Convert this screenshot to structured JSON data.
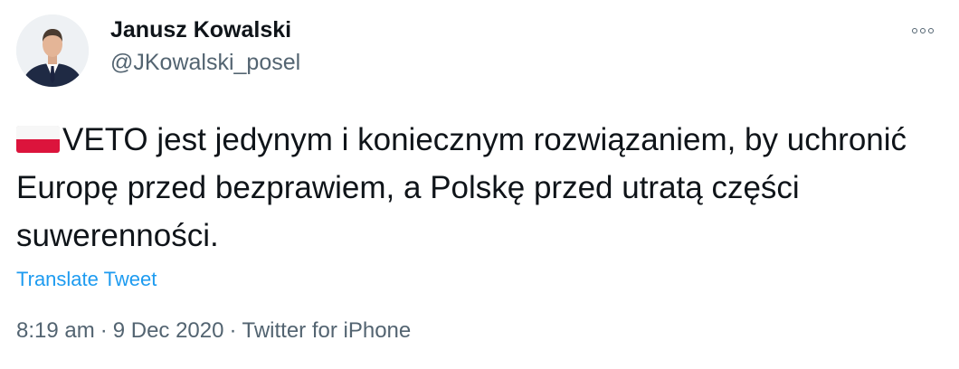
{
  "author": {
    "name": "Janusz Kowalski",
    "handle": "@JKowalski_posel"
  },
  "more_icon": "more-horizontal-icon",
  "tweet": {
    "flag_icon": "poland-flag-emoji",
    "text": "VETO jest jedynym i koniecznym rozwiązaniem, by uchronić Europę przed bezprawiem, a Polskę przed utratą części suwerenności.",
    "translate_label": "Translate Tweet"
  },
  "meta": {
    "time": "8:19 am",
    "separator": "·",
    "date": "9 Dec 2020",
    "source": "Twitter for iPhone"
  },
  "colors": {
    "text": "#0f1419",
    "secondary": "#536471",
    "link": "#1d9bf0",
    "flag_red": "#dc143c",
    "flag_white": "#f7f7f7"
  }
}
